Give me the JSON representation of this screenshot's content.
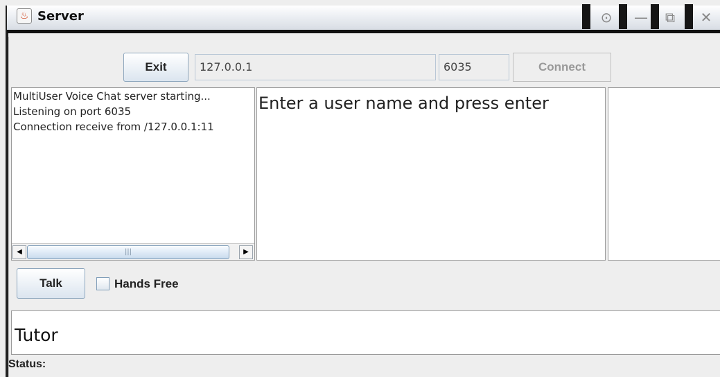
{
  "window": {
    "title": "Server",
    "title_icon": "java-cup-icon",
    "controls": [
      "record-icon",
      "minimize-icon",
      "restore-icon",
      "close-icon"
    ]
  },
  "toolbar": {
    "exit_label": "Exit",
    "host_value": "127.0.0.1",
    "port_value": "6035",
    "connect_label": "Connect"
  },
  "log": {
    "lines": [
      "MultiUser Voice Chat server starting...",
      "Listening on port 6035",
      "Connection receive from /127.0.0.1:11"
    ]
  },
  "center": {
    "prompt": "Enter a user name and press enter"
  },
  "controls": {
    "talk_label": "Talk",
    "hands_free_label": "Hands Free",
    "hands_free_checked": false
  },
  "input": {
    "value": "Tutor"
  },
  "status": {
    "label": "Status:"
  }
}
